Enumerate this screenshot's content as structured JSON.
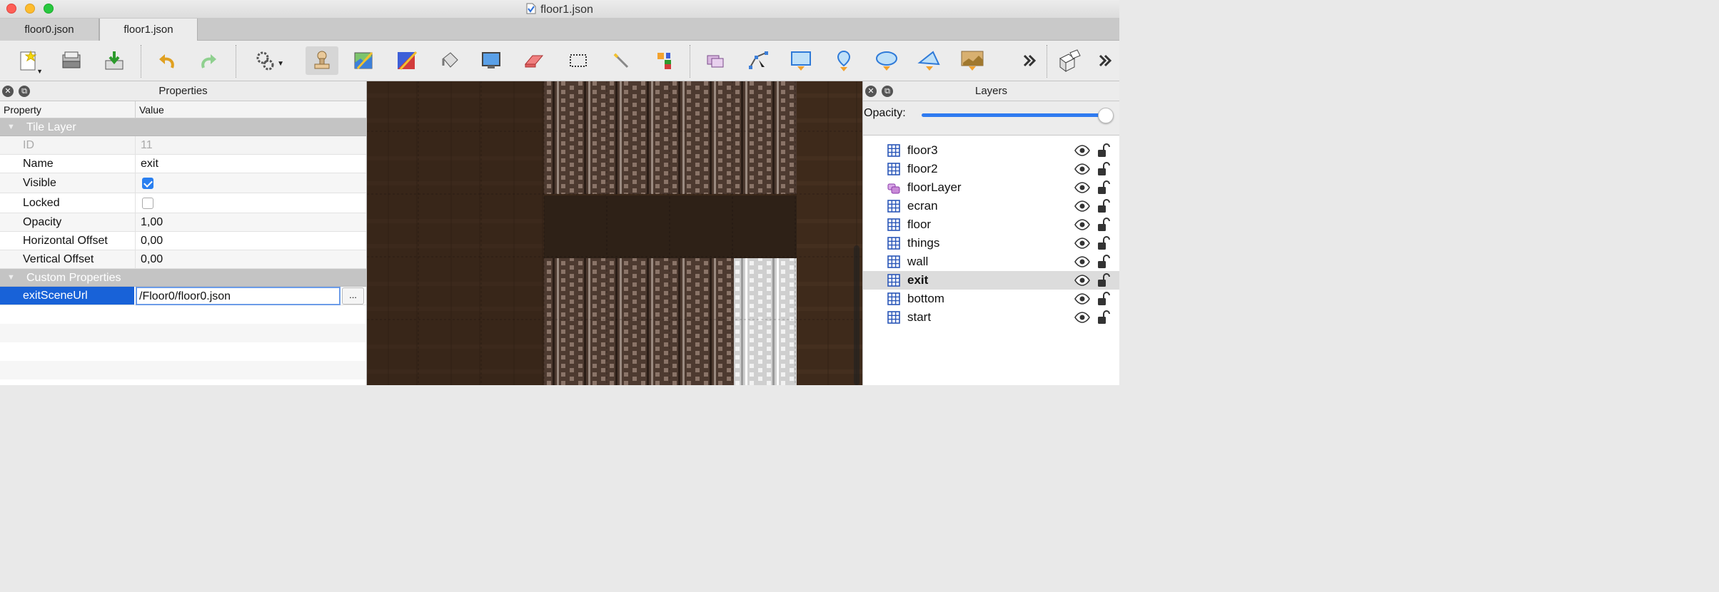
{
  "window": {
    "title": "floor1.json"
  },
  "tabs": [
    {
      "label": "floor0.json",
      "active": false
    },
    {
      "label": "floor1.json",
      "active": true
    }
  ],
  "toolbar": {
    "tools": [
      "new-icon",
      "open-icon",
      "save-icon",
      "undo-icon",
      "redo-icon",
      "commands-icon",
      "stamp-brush-icon",
      "terrain-brush-icon",
      "wang-brush-icon",
      "bucket-fill-icon",
      "shape-fill-icon",
      "eraser-icon",
      "rect-select-icon",
      "magic-wand-icon",
      "select-same-tile-icon",
      "select-objects-icon",
      "edit-polygons-icon",
      "insert-rectangle-icon",
      "insert-point-icon",
      "insert-ellipse-icon",
      "insert-polygon-icon",
      "insert-tile-icon",
      "more-icon",
      "random-mode-icon",
      "more-icon-2"
    ]
  },
  "properties": {
    "title": "Properties",
    "col_property": "Property",
    "col_value": "Value",
    "group_tile_layer": "Tile Layer",
    "rows": {
      "id": {
        "name": "ID",
        "value": "11"
      },
      "name": {
        "name": "Name",
        "value": "exit"
      },
      "visible": {
        "name": "Visible",
        "checked": true
      },
      "locked": {
        "name": "Locked",
        "checked": false
      },
      "opacity": {
        "name": "Opacity",
        "value": "1,00"
      },
      "hoffset": {
        "name": "Horizontal Offset",
        "value": "0,00"
      },
      "voffset": {
        "name": "Vertical Offset",
        "value": "0,00"
      }
    },
    "group_custom": "Custom Properties",
    "custom": {
      "name": "exitSceneUrl",
      "value": "/Floor0/floor0.json",
      "button": "..."
    }
  },
  "layers": {
    "title": "Layers",
    "opacity_label": "Opacity:",
    "opacity_value": 1.0,
    "items": [
      {
        "name": "floor3",
        "type": "tile"
      },
      {
        "name": "floor2",
        "type": "tile"
      },
      {
        "name": "floorLayer",
        "type": "object"
      },
      {
        "name": "ecran",
        "type": "tile"
      },
      {
        "name": "floor",
        "type": "tile"
      },
      {
        "name": "things",
        "type": "tile"
      },
      {
        "name": "wall",
        "type": "tile"
      },
      {
        "name": "exit",
        "type": "tile",
        "selected": true
      },
      {
        "name": "bottom",
        "type": "tile"
      },
      {
        "name": "start",
        "type": "tile"
      }
    ]
  },
  "colors": {
    "accent": "#1862d8",
    "map_floor": "#3f2b1c"
  }
}
